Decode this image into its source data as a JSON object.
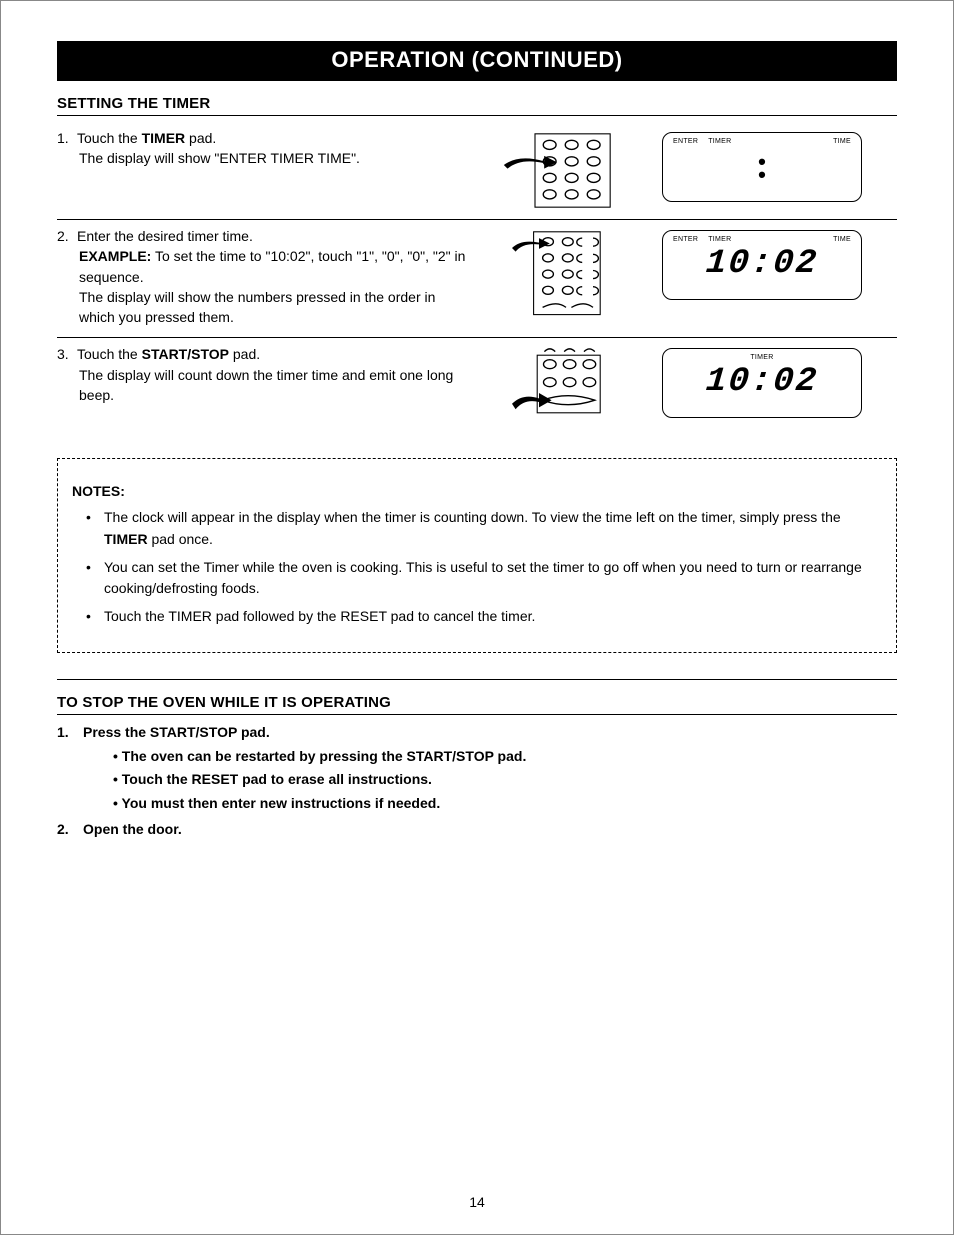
{
  "header": {
    "title": "OPERATION (CONTINUED)"
  },
  "timer": {
    "title": "SETTING THE TIMER",
    "steps": [
      {
        "num": "1.",
        "line1_pre": "Touch the ",
        "line1_bold": "TIMER",
        "line1_post": " pad.",
        "line2": "The display will show \"ENTER TIMER TIME\".",
        "display": {
          "left1": "ENTER",
          "left2": "TIMER",
          "right": "TIME",
          "value": "",
          "colon_only": true
        }
      },
      {
        "num": "2.",
        "line1": "Enter the desired timer time.",
        "ex_label": "EXAMPLE:",
        "ex_text": " To set the time to \"10:02\", touch \"1\", \"0\", \"0\", \"2\" in sequence.",
        "line3": "The display will show the numbers pressed in the order in which you pressed them.",
        "display": {
          "left1": "ENTER",
          "left2": "TIMER",
          "right": "TIME",
          "value": "10:02",
          "colon_only": false
        }
      },
      {
        "num": "3.",
        "line1_pre": "Touch the ",
        "line1_bold": "START/STOP",
        "line1_post": " pad.",
        "line2": "The display will count down the timer time and emit one long beep.",
        "display": {
          "center": "TIMER",
          "value": "10:02",
          "colon_only": false
        }
      }
    ]
  },
  "notes": {
    "title": "NOTES:",
    "items": [
      {
        "pre": "The clock will appear in the display when the timer is counting down. To view the time left on the timer, simply press the ",
        "bold": "TIMER",
        "post": " pad once."
      },
      {
        "text": "You can set the Timer while the oven is cooking. This is useful to set the timer to go off when you need to turn or rearrange cooking/defrosting foods."
      },
      {
        "text": "Touch the TIMER pad followed by the RESET pad to cancel the timer."
      }
    ]
  },
  "stop": {
    "title": "TO STOP THE OVEN WHILE IT IS OPERATING",
    "item1_num": "1.",
    "item1_text": "Press the START/STOP pad.",
    "sub": [
      "The oven can be restarted by pressing the START/STOP pad.",
      "Touch the RESET pad  to erase all instructions.",
      "You must then enter new instructions if needed."
    ],
    "item2_num": "2.",
    "item2_text": "Open the door."
  },
  "page_number": "14"
}
